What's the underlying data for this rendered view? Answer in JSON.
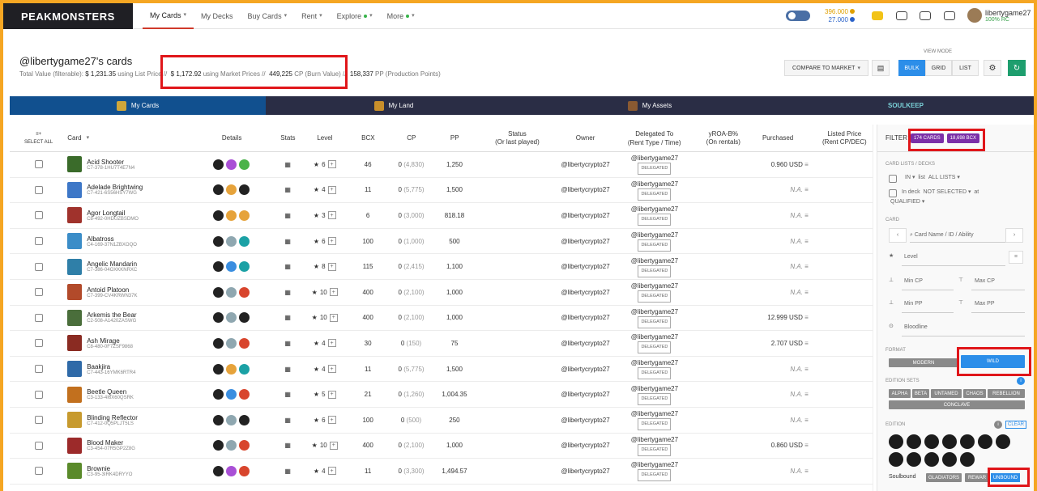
{
  "topbar": {
    "logo": "PEAKMONSTERS",
    "nav": [
      {
        "label": "My Cards",
        "caret": true,
        "active": true
      },
      {
        "label": "My Decks",
        "caret": false
      },
      {
        "label": "Buy Cards",
        "caret": true
      },
      {
        "label": "Rent",
        "caret": true
      },
      {
        "label": "Explore",
        "caret": true,
        "dot": true
      },
      {
        "label": "More",
        "caret": true,
        "dot": true
      }
    ],
    "balance1": "396.000",
    "balance2": "27.000",
    "username": "libertygame27",
    "rc": "100% RC"
  },
  "header": {
    "title": "@libertygame27's cards",
    "total_label": "Total Value (filterable):",
    "list_value": "$ 1,231.35",
    "list_text": "using List Price //",
    "market_value": "$ 1,172.92",
    "market_text": "using Market Prices //",
    "cp_value": "449,225",
    "cp_text": "CP (Burn Value) //",
    "pp_value": "158,337",
    "pp_text": "PP (Production Points)",
    "compare": "COMPARE TO MARKET",
    "view_mode": "VIEW MODE",
    "views": [
      "BULK",
      "GRID",
      "LIST"
    ]
  },
  "tabs": [
    "My Cards",
    "My Land",
    "My Assets",
    "SOULKEEP"
  ],
  "columns": {
    "select_all": "SELECT ALL",
    "card": "Card",
    "details": "Details",
    "stats": "Stats",
    "level": "Level",
    "bcx": "BCX",
    "cp": "CP",
    "pp": "PP",
    "status": "Status",
    "status2": "(Or last played)",
    "owner": "Owner",
    "delegated": "Delegated To",
    "delegated2": "(Rent Type / Time)",
    "yroa": "yROA-B%",
    "yroa2": "(On rentals)",
    "purchased": "Purchased",
    "listed": "Listed Price",
    "listed2": "(Rent CP/DEC)"
  },
  "rows": [
    {
      "name": "Acid Shooter",
      "id": "C7-378-1HU7T4E7N4",
      "level": "6",
      "bcx": "46",
      "cp": "0",
      "cp_burn": "(4,830)",
      "pp": "1,250",
      "owner": "@libertycrypto27",
      "delegated": "@libertygame27",
      "tag": "DELEGATED",
      "purchased": "0.960 USD",
      "thumb": "#3a6b2a",
      "icons": [
        "#222",
        "#a950d6",
        "#4bb34a"
      ]
    },
    {
      "name": "Adelade Brightwing",
      "id": "C7-421-6S56HSY7WG",
      "level": "4",
      "bcx": "11",
      "cp": "0",
      "cp_burn": "(5,775)",
      "pp": "1,500",
      "owner": "@libertycrypto27",
      "delegated": "@libertygame27",
      "tag": "DELEGATED",
      "purchased": "N.A.",
      "thumb": "#3d77c7",
      "icons": [
        "#222",
        "#e6a33b",
        "#222"
      ]
    },
    {
      "name": "Agor Longtail",
      "id": "C8-492-0HDUZBSDMO",
      "level": "3",
      "bcx": "6",
      "cp": "0",
      "cp_burn": "(3,000)",
      "pp": "818.18",
      "owner": "@libertycrypto27",
      "delegated": "@libertygame27",
      "tag": "DELEGATED",
      "purchased": "N.A.",
      "thumb": "#a0322c",
      "icons": [
        "#222",
        "#e6a33b",
        "#e6a33b"
      ]
    },
    {
      "name": "Albatross",
      "id": "C4-169-37N1ZBXOQO",
      "level": "6",
      "bcx": "100",
      "cp": "0",
      "cp_burn": "(1,000)",
      "pp": "500",
      "owner": "@libertycrypto27",
      "delegated": "@libertygame27",
      "tag": "DELEGATED",
      "purchased": "N.A.",
      "thumb": "#3b8dc8",
      "icons": [
        "#222",
        "#8fa7b0",
        "#1ba1a5"
      ]
    },
    {
      "name": "Angelic Mandarin",
      "id": "C7-386-04OXKKNRXC",
      "level": "8",
      "bcx": "115",
      "cp": "0",
      "cp_burn": "(2,415)",
      "pp": "1,100",
      "owner": "@libertycrypto27",
      "delegated": "@libertygame27",
      "tag": "DELEGATED",
      "purchased": "N.A.",
      "thumb": "#2f7fa8",
      "icons": [
        "#222",
        "#3a8ee0",
        "#1ba1a5"
      ]
    },
    {
      "name": "Antoid Platoon",
      "id": "C7-399-CV4KRWN37K",
      "level": "10",
      "bcx": "400",
      "cp": "0",
      "cp_burn": "(2,100)",
      "pp": "1,000",
      "owner": "@libertycrypto27",
      "delegated": "@libertygame27",
      "tag": "DELEGATED",
      "purchased": "N.A.",
      "thumb": "#b24a2a",
      "icons": [
        "#222",
        "#8fa7b0",
        "#d8452d"
      ]
    },
    {
      "name": "Arkemis the Bear",
      "id": "C2-508-A1420ZASWG",
      "level": "10",
      "bcx": "400",
      "cp": "0",
      "cp_burn": "(2,100)",
      "pp": "1,000",
      "owner": "@libertycrypto27",
      "delegated": "@libertygame27",
      "tag": "DELEGATED",
      "purchased": "12.999 USD",
      "thumb": "#4a6e3b",
      "icons": [
        "#222",
        "#8fa7b0",
        "#222"
      ]
    },
    {
      "name": "Ash Mirage",
      "id": "C8-480-0F7ZSF9868",
      "level": "4",
      "bcx": "30",
      "cp": "0",
      "cp_burn": "(150)",
      "pp": "75",
      "owner": "@libertycrypto27",
      "delegated": "@libertygame27",
      "tag": "DELEGATED",
      "purchased": "2.707 USD",
      "thumb": "#8a2b22",
      "icons": [
        "#222",
        "#8fa7b0",
        "#d8452d"
      ]
    },
    {
      "name": "Baakjira",
      "id": "C7-443-16YMK6RTR4",
      "level": "4",
      "bcx": "11",
      "cp": "0",
      "cp_burn": "(5,775)",
      "pp": "1,500",
      "owner": "@libertycrypto27",
      "delegated": "@libertygame27",
      "tag": "DELEGATED",
      "purchased": "N.A.",
      "thumb": "#2f6aa8",
      "icons": [
        "#222",
        "#e6a33b",
        "#1ba1a5"
      ]
    },
    {
      "name": "Beetle Queen",
      "id": "C3-133-4I6X60QSRK",
      "level": "5",
      "bcx": "21",
      "cp": "0",
      "cp_burn": "(1,260)",
      "pp": "1,004.35",
      "owner": "@libertycrypto27",
      "delegated": "@libertygame27",
      "tag": "DELEGATED",
      "purchased": "N.A.",
      "thumb": "#c2701e",
      "icons": [
        "#222",
        "#3a8ee0",
        "#d8452d"
      ]
    },
    {
      "name": "Blinding Reflector",
      "id": "C7-412-0Q5PLJT5LS",
      "level": "6",
      "bcx": "100",
      "cp": "0",
      "cp_burn": "(500)",
      "pp": "250",
      "owner": "@libertycrypto27",
      "delegated": "@libertygame27",
      "tag": "DELEGATED",
      "purchased": "N.A.",
      "thumb": "#c79a2e",
      "icons": [
        "#222",
        "#8fa7b0",
        "#222"
      ]
    },
    {
      "name": "Blood Maker",
      "id": "C3-454-07R5GP2Z8G",
      "level": "10",
      "bcx": "400",
      "cp": "0",
      "cp_burn": "(2,100)",
      "pp": "1,000",
      "owner": "@libertycrypto27",
      "delegated": "@libertygame27",
      "tag": "DELEGATED",
      "purchased": "0.860 USD",
      "thumb": "#9c2a2a",
      "icons": [
        "#222",
        "#8fa7b0",
        "#d8452d"
      ]
    },
    {
      "name": "Brownie",
      "id": "C3-95-3IRK4DRYYO",
      "level": "4",
      "bcx": "11",
      "cp": "0",
      "cp_burn": "(3,300)",
      "pp": "1,494.57",
      "owner": "@libertycrypto27",
      "delegated": "@libertygame27",
      "tag": "DELEGATED",
      "purchased": "N.A.",
      "thumb": "#5a8a2a",
      "icons": [
        "#222",
        "#a950d6",
        "#d8452d"
      ]
    }
  ],
  "filter": {
    "title": "FILTER",
    "cards": "174 CARDS",
    "bcx": "18,698 BCX",
    "lists_label": "CARD LISTS / DECKS",
    "in": "IN",
    "list": "list",
    "all_lists": "ALL LISTS",
    "in_deck": "In deck",
    "not_selected": "NOT SELECTED",
    "at": "at",
    "qualified": "QUALIFIED",
    "card_label": "CARD",
    "card_placeholder": "Card Name / ID / Ability",
    "level": "Level",
    "eq": "=",
    "min_cp": "Min CP",
    "max_cp": "Max CP",
    "min_pp": "Min PP",
    "max_pp": "Max PP",
    "bloodline": "Bloodline",
    "format": "FORMAT",
    "modern": "MODERN",
    "wild": "WILD",
    "edition_sets": "EDITION SETS",
    "sets": [
      "ALPHA",
      "BETA",
      "UNTAMED",
      "CHAOS",
      "REBELLION"
    ],
    "conclave": "CONCLAVE",
    "edition": "EDITION",
    "clear": "CLEAR",
    "soulbound": "Soulbound",
    "gladiators": "GLADIATORS",
    "rewards": "REWAR",
    "unbound": "UNBOUND"
  }
}
